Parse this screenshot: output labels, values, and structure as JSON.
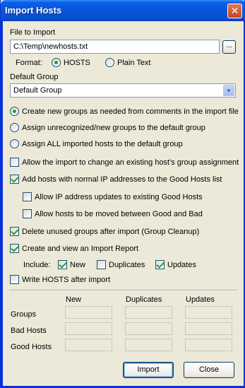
{
  "window": {
    "title": "Import Hosts",
    "close_glyph": "✕"
  },
  "file": {
    "label": "File to Import",
    "value": "C:\\Temp\\newhosts.txt",
    "browse_label": "..."
  },
  "format": {
    "label": "Format:",
    "options": [
      {
        "label": "HOSTS",
        "selected": true
      },
      {
        "label": "Plain Text",
        "selected": false
      }
    ]
  },
  "default_group": {
    "label": "Default Group",
    "selected": "Default Group"
  },
  "group_mode": [
    {
      "label": "Create new groups as needed from comments in the import file",
      "selected": true
    },
    {
      "label": "Assign unrecognized/new groups to the default group",
      "selected": false
    },
    {
      "label": "Assign ALL imported hosts to the default group",
      "selected": false
    }
  ],
  "options": {
    "allow_change": {
      "label": "Allow the import to change an existing host's group assignment",
      "checked": false
    },
    "add_good": {
      "label": "Add hosts with normal IP addresses to the Good Hosts list",
      "checked": true
    },
    "allow_ip_updates": {
      "label": "Allow IP address updates to existing Good Hosts",
      "checked": false
    },
    "allow_move": {
      "label": "Allow hosts to be moved between Good and Bad",
      "checked": false
    },
    "delete_unused": {
      "label": "Delete unused groups after import (Group Cleanup)",
      "checked": true
    },
    "create_report": {
      "label": "Create and view an Import Report",
      "checked": true
    },
    "write_hosts": {
      "label": "Write HOSTS after import",
      "checked": false
    }
  },
  "include": {
    "label": "Include:",
    "items": [
      {
        "label": "New",
        "checked": true
      },
      {
        "label": "Duplicates",
        "checked": false
      },
      {
        "label": "Updates",
        "checked": true
      }
    ]
  },
  "stats": {
    "columns": [
      "New",
      "Duplicates",
      "Updates"
    ],
    "rows": [
      "Groups",
      "Bad Hosts",
      "Good Hosts"
    ]
  },
  "buttons": {
    "import": "Import",
    "close": "Close"
  }
}
